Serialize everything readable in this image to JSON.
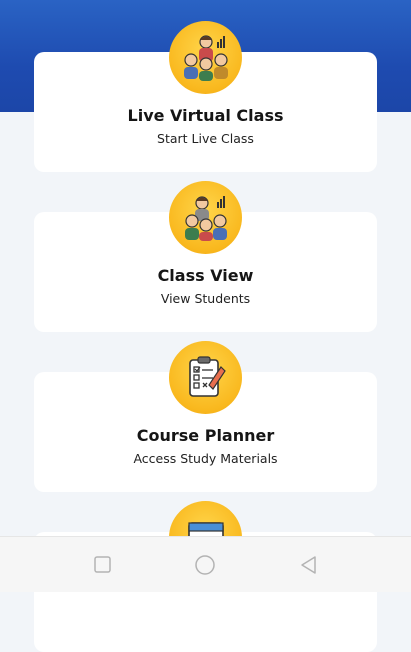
{
  "cards": [
    {
      "title": "Live Virtual Class",
      "subtitle": "Start Live Class",
      "icon": "virtual-class-icon"
    },
    {
      "title": "Class View",
      "subtitle": "View Students",
      "icon": "classroom-icon"
    },
    {
      "title": "Course Planner",
      "subtitle": "Access Study Materials",
      "icon": "clipboard-checklist-icon"
    },
    {
      "title": "",
      "subtitle": "",
      "icon": "calendar-icon"
    }
  ],
  "navbar": {
    "buttons": [
      "square-icon",
      "circle-icon",
      "back-triangle-icon"
    ]
  },
  "colors": {
    "header": "#1e4bb0",
    "accent": "#f9b81e",
    "background": "#f2f5f9"
  }
}
